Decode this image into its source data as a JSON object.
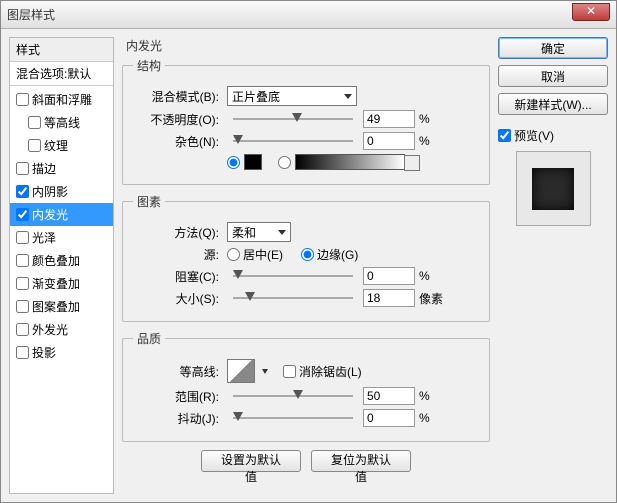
{
  "window": {
    "title": "图层样式"
  },
  "styles": {
    "header": "样式",
    "blend_defaults": "混合选项:默认",
    "items": [
      {
        "label": "斜面和浮雕",
        "checked": false,
        "selected": false
      },
      {
        "label": "等高线",
        "checked": false,
        "selected": false,
        "sub": true
      },
      {
        "label": "纹理",
        "checked": false,
        "selected": false,
        "sub": true
      },
      {
        "label": "描边",
        "checked": false,
        "selected": false
      },
      {
        "label": "内阴影",
        "checked": true,
        "selected": false
      },
      {
        "label": "内发光",
        "checked": true,
        "selected": true
      },
      {
        "label": "光泽",
        "checked": false,
        "selected": false
      },
      {
        "label": "颜色叠加",
        "checked": false,
        "selected": false
      },
      {
        "label": "渐变叠加",
        "checked": false,
        "selected": false
      },
      {
        "label": "图案叠加",
        "checked": false,
        "selected": false
      },
      {
        "label": "外发光",
        "checked": false,
        "selected": false
      },
      {
        "label": "投影",
        "checked": false,
        "selected": false
      }
    ]
  },
  "panel": {
    "title": "内发光",
    "structure": {
      "legend": "结构",
      "blend_mode_label": "混合模式(B):",
      "blend_mode_value": "正片叠底",
      "opacity_label": "不透明度(O):",
      "opacity_value": "49",
      "opacity_unit": "%",
      "noise_label": "杂色(N):",
      "noise_value": "0",
      "noise_unit": "%"
    },
    "elements": {
      "legend": "图素",
      "technique_label": "方法(Q):",
      "technique_value": "柔和",
      "source_label": "源:",
      "source_center": "居中(E)",
      "source_edge": "边缘(G)",
      "choke_label": "阻塞(C):",
      "choke_value": "0",
      "choke_unit": "%",
      "size_label": "大小(S):",
      "size_value": "18",
      "size_unit": "像素"
    },
    "quality": {
      "legend": "品质",
      "contour_label": "等高线:",
      "antialias_label": "消除锯齿(L)",
      "range_label": "范围(R):",
      "range_value": "50",
      "range_unit": "%",
      "jitter_label": "抖动(J):",
      "jitter_value": "0",
      "jitter_unit": "%"
    },
    "buttons": {
      "make_default": "设置为默认值",
      "reset_default": "复位为默认值"
    }
  },
  "right": {
    "ok": "确定",
    "cancel": "取消",
    "new_style": "新建样式(W)...",
    "preview_label": "预览(V)"
  }
}
